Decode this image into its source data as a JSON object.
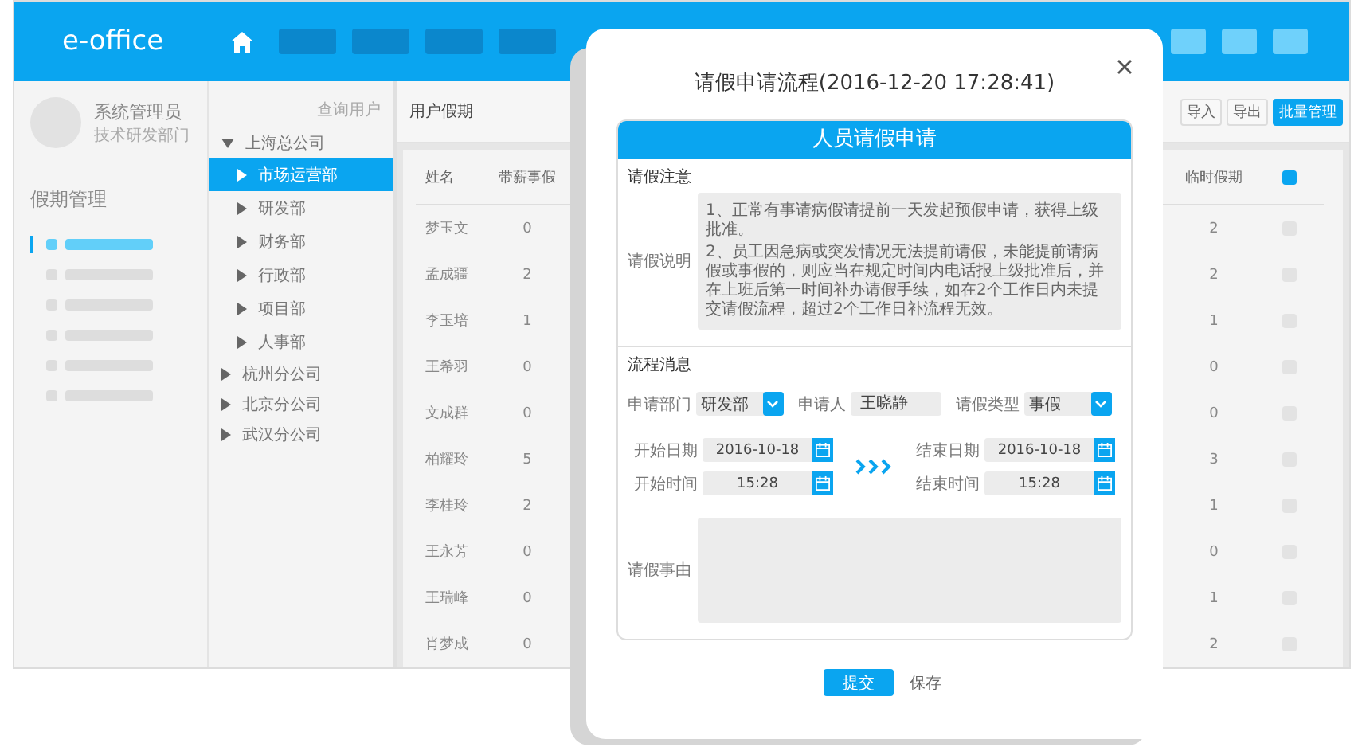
{
  "app": {
    "logo": "e-office"
  },
  "sidebar": {
    "user_name": "系统管理员",
    "department": "技术研发部门",
    "section_title": "假期管理",
    "menu_items": [
      {
        "selected": true
      },
      {
        "selected": false
      },
      {
        "selected": false
      },
      {
        "selected": false
      },
      {
        "selected": false
      },
      {
        "selected": false
      }
    ]
  },
  "tree": {
    "search_link": "查询用户",
    "nodes": [
      {
        "label": "上海总公司",
        "expanded": true,
        "selected": false,
        "children": [
          {
            "label": "市场运营部",
            "expanded": false,
            "selected": true
          },
          {
            "label": "研发部",
            "expanded": false,
            "selected": false
          },
          {
            "label": "财务部",
            "expanded": false,
            "selected": false
          },
          {
            "label": "行政部",
            "expanded": false,
            "selected": false
          },
          {
            "label": "项目部",
            "expanded": false,
            "selected": false
          },
          {
            "label": "人事部",
            "expanded": false,
            "selected": false
          }
        ]
      },
      {
        "label": "杭州分公司",
        "expanded": false,
        "selected": false
      },
      {
        "label": "北京分公司",
        "expanded": false,
        "selected": false
      },
      {
        "label": "武汉分公司",
        "expanded": false,
        "selected": false
      }
    ]
  },
  "main": {
    "breadcrumb": "用户假期",
    "buttons": [
      {
        "label": "导入",
        "kind": "plain"
      },
      {
        "label": "导出",
        "kind": "plain"
      },
      {
        "label": "批量管理",
        "kind": "primary"
      }
    ],
    "table": {
      "columns": [
        "姓名",
        "带薪事假",
        "临时假期"
      ],
      "select_all_checked": true,
      "rows": [
        {
          "name": "梦玉文",
          "column_2": "0",
          "column_3": "2",
          "checked": false
        },
        {
          "name": "孟成疆",
          "column_2": "2",
          "column_3": "2",
          "checked": false
        },
        {
          "name": "李玉培",
          "column_2": "1",
          "column_3": "1",
          "checked": false
        },
        {
          "name": "王希羽",
          "column_2": "0",
          "column_3": "0",
          "checked": false
        },
        {
          "name": "文成群",
          "column_2": "0",
          "column_3": "0",
          "checked": false
        },
        {
          "name": "柏耀玲",
          "column_2": "5",
          "column_3": "3",
          "checked": false
        },
        {
          "name": "李桂玲",
          "column_2": "2",
          "column_3": "1",
          "checked": false
        },
        {
          "name": "王永芳",
          "column_2": "0",
          "column_3": "0",
          "checked": false
        },
        {
          "name": "王瑞峰",
          "column_2": "0",
          "column_3": "1",
          "checked": false
        },
        {
          "name": "肖梦成",
          "column_2": "0",
          "column_3": "2",
          "checked": false
        }
      ]
    }
  },
  "dialog": {
    "title": "请假申请流程(2016-12-20 17:28:41)",
    "form_title": "人员请假申请",
    "notice_heading": "请假注意",
    "notice_label": "请假说明",
    "notices": [
      "1、正常有事请病假请提前一天发起预假申请，获得上级批准。",
      "2、员工因急病或突发情况无法提前请假，未能提前请病假或事假的，则应当在规定时间内电话报上级批准后，并在上班后第一时间补办请假手续，如在2个工作日内未提交请假流程，超过2个工作日补流程无效。"
    ],
    "flow_heading": "流程消息",
    "department": {
      "label": "申请部门",
      "value": "研发部"
    },
    "applicant": {
      "label": "申请人",
      "value": "王晓静"
    },
    "leave_type": {
      "label": "请假类型",
      "value": "事假"
    },
    "start_date": {
      "label": "开始日期",
      "value": "2016-10-18"
    },
    "end_date": {
      "label": "结束日期",
      "value": "2016-10-18"
    },
    "start_time": {
      "label": "开始时间",
      "value": "15:28"
    },
    "end_time": {
      "label": "结束时间",
      "value": "15:28"
    },
    "reason": {
      "label": "请假事由"
    },
    "submit": "提交",
    "save": "保存"
  }
}
